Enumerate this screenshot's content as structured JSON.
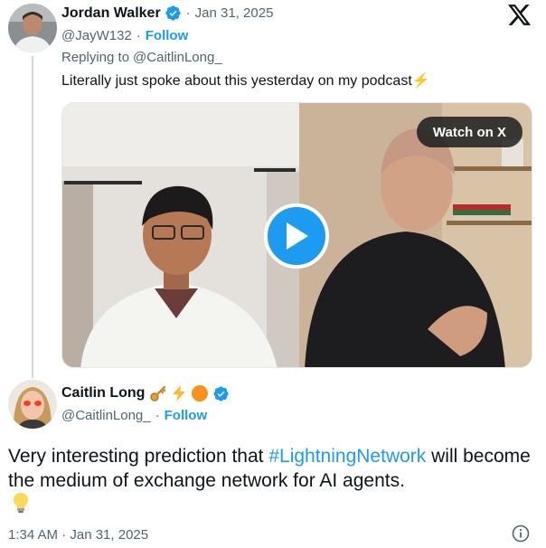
{
  "reply_tweet": {
    "display_name": "Jordan Walker",
    "separator": "·",
    "date": "Jan 31, 2025",
    "handle": "@JayW132",
    "dot": "·",
    "follow_label": "Follow",
    "replying_prefix": "Replying to",
    "replying_handle": "@CaitlinLong_",
    "text": "Literally just spoke about this yesterday on my podcast⚡"
  },
  "video": {
    "watch_label": "Watch on X"
  },
  "quoted_tweet": {
    "display_name": "Caitlin Long",
    "name_emojis": [
      "key-emoji",
      "lightning-emoji",
      "orange-circle-emoji"
    ],
    "handle": "@CaitlinLong_",
    "dot": "·",
    "follow_label": "Follow",
    "text_before": "Very interesting prediction that ",
    "hashtag": "#LightningNetwork",
    "text_after": " will become the medium of exchange network for AI agents.",
    "trailing_emoji": "light-bulb-emoji",
    "timestamp": "1:34 AM · Jan 31, 2025"
  },
  "colors": {
    "accent": "#1d9bf0",
    "text": "#0f1419",
    "muted": "#536471"
  }
}
